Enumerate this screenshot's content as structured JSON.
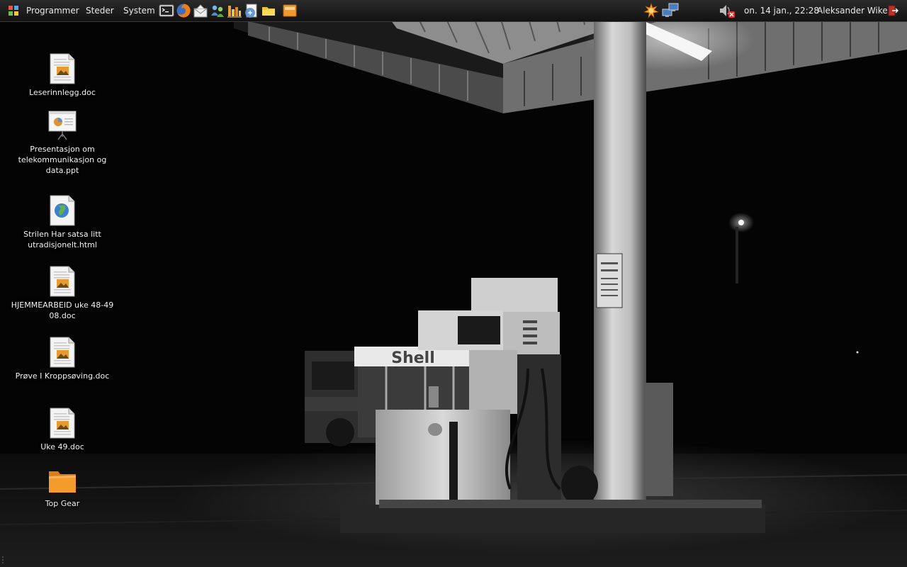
{
  "panel": {
    "menus": [
      "Programmer",
      "Steder",
      "System"
    ],
    "clock": "on. 14 jan., 22:28",
    "user": "Aleksander Wiken"
  },
  "launchers": [
    "terminal-icon",
    "firefox-icon",
    "mail-icon",
    "messenger-icon",
    "system-monitor-icon",
    "writer-icon",
    "folder-icon",
    "presentation-icon"
  ],
  "tray": [
    "update-notifier-icon",
    "network-icon",
    "volume-muted-icon",
    "logout-icon"
  ],
  "desktop": {
    "icons": [
      {
        "label": "Leserinnlegg.doc",
        "type": "doc"
      },
      {
        "label": "Presentasjon om telekommunikasjon og data.ppt",
        "type": "ppt"
      },
      {
        "label": "Strilen Har satsa litt utradisjonelt.html",
        "type": "html"
      },
      {
        "label": "HJEMMEARBEID uke 48-49 08.doc",
        "type": "doc"
      },
      {
        "label": "Prøve I Kroppsøving.doc",
        "type": "doc"
      },
      {
        "label": "Uke 49.doc",
        "type": "doc"
      },
      {
        "label": "Top Gear",
        "type": "folder"
      }
    ]
  },
  "wallpaper": {
    "sign": "Shell",
    "description_visible": "night gas station photo"
  },
  "colors": {
    "panel": "#1c1c1c",
    "panel_text": "#e8e8e8",
    "folder": "#f39c2b",
    "update_notifier": "#ff9a1a"
  }
}
